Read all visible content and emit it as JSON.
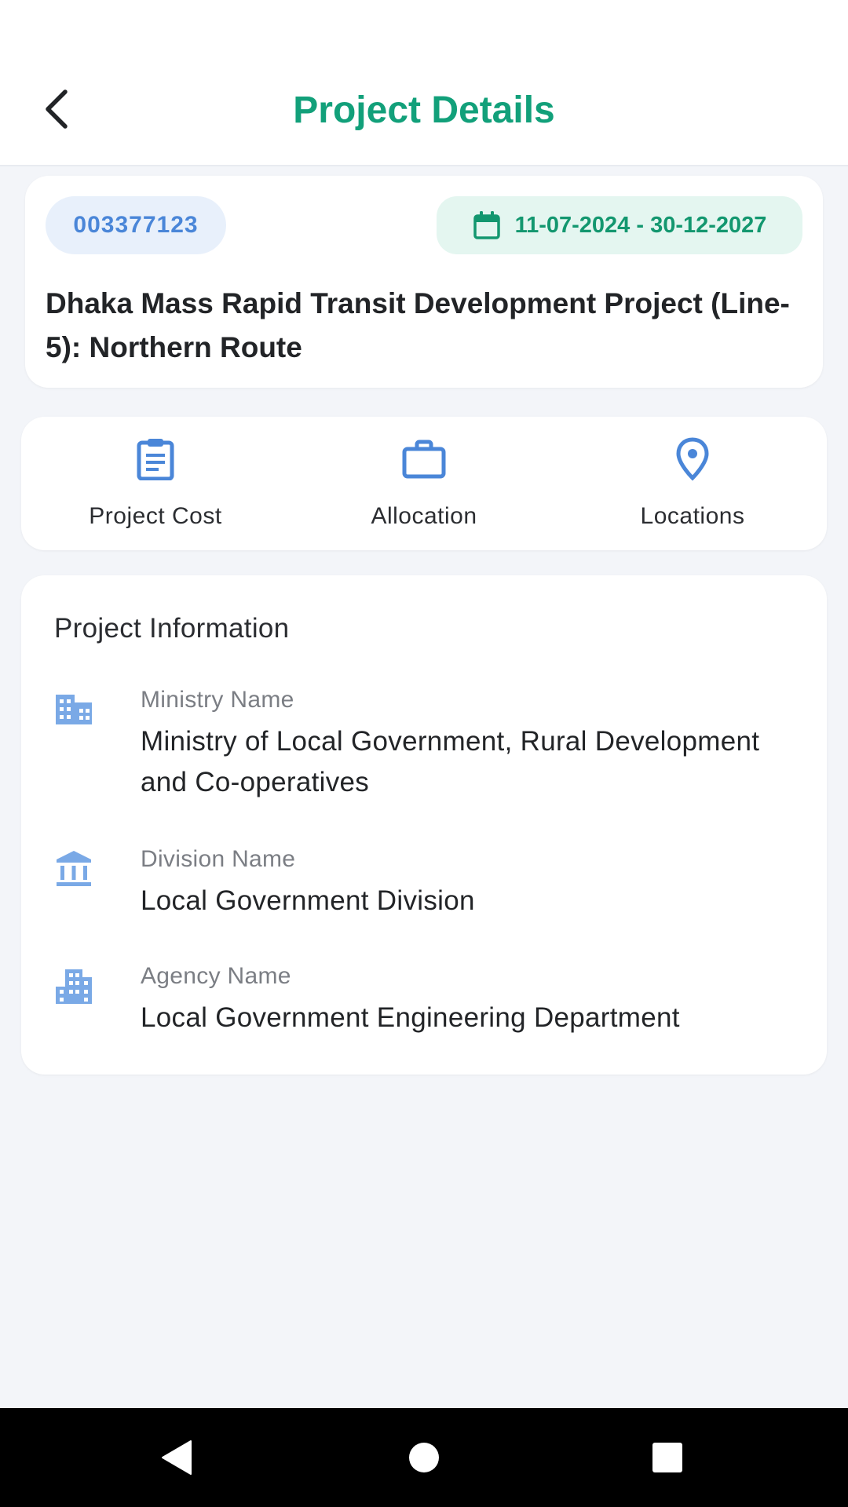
{
  "header": {
    "title": "Project Details"
  },
  "project": {
    "id": "003377123",
    "date_range": "11-07-2024 - 30-12-2027",
    "title": "Dhaka Mass Rapid Transit Development Project (Line-5): Northern Route"
  },
  "actions": [
    {
      "label": "Project Cost",
      "icon": "clipboard-icon"
    },
    {
      "label": "Allocation",
      "icon": "briefcase-icon"
    },
    {
      "label": "Locations",
      "icon": "location-pin-icon"
    }
  ],
  "info": {
    "heading": "Project Information",
    "rows": [
      {
        "label": "Ministry Name",
        "value": "Ministry of Local Government, Rural Development and Co-operatives",
        "icon": "building-icon"
      },
      {
        "label": "Division Name",
        "value": "Local Government Division",
        "icon": "bank-icon"
      },
      {
        "label": "Agency Name",
        "value": "Local Government Engineering Department",
        "icon": "apartment-icon"
      }
    ]
  },
  "colors": {
    "accent_green": "#12a07a",
    "accent_blue": "#4a86d8",
    "background": "#f3f5f9"
  }
}
